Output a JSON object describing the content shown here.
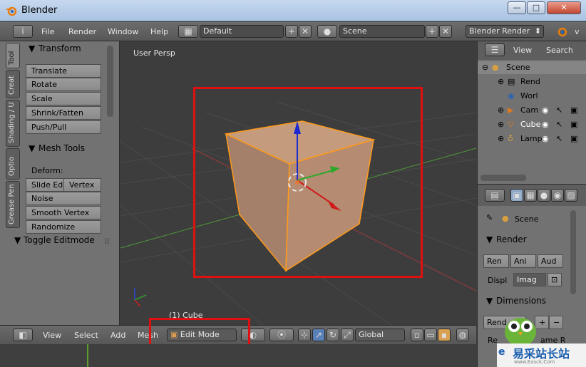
{
  "window": {
    "title": "Blender",
    "min_label": "—",
    "max_label": "□",
    "close_label": "✕"
  },
  "header": {
    "menus": [
      "File",
      "Render",
      "Window",
      "Help"
    ],
    "layout_value": "Default",
    "scene_value": "Scene",
    "engine_value": "Blender Render",
    "engine_cut": "v"
  },
  "tool_tabs": [
    "Tool",
    "Creat",
    "Shading / U",
    "Optio",
    "Grease Pen"
  ],
  "tool_panel": {
    "transform_header": "Transform",
    "transform_buttons": [
      "Translate",
      "Rotate",
      "Scale",
      "Shrink/Fatten",
      "Push/Pull"
    ],
    "mesh_tools_header": "Mesh Tools",
    "deform_label": "Deform:",
    "slide_edge": "Slide Ed",
    "vertex": "Vertex",
    "mesh_buttons": [
      "Noise",
      "Smooth Vertex",
      "Randomize"
    ],
    "toggle_editmode": "Toggle Editmode"
  },
  "viewport": {
    "view_label": "User Persp",
    "object_label": "(1) Cube"
  },
  "bottom_bar": {
    "menus": [
      "View",
      "Select",
      "Add",
      "Mesh"
    ],
    "mode_value": "Edit Mode",
    "orientation_value": "Global"
  },
  "outliner": {
    "view_menu": "View",
    "search_menu": "Search",
    "items": [
      "Scene",
      "Rend",
      "Worl",
      "Cam",
      "Cube",
      "Lamp"
    ]
  },
  "properties": {
    "context": "Scene",
    "render_header": "Render",
    "render_buttons": [
      "Ren",
      "Ani",
      "Aud"
    ],
    "display_label": "Displ",
    "display_value": "Imag",
    "dimensions_header": "Dimensions",
    "render_preset": "Rend",
    "resolution_label": "Re",
    "frame_label": "ame R"
  },
  "watermark": {
    "text": "易采站长站",
    "subtext": "www.Easck.Com"
  },
  "colors": {
    "highlight_box": "#e01010",
    "cube_face": "#b08a6e",
    "cube_edge": "#ff9a1a"
  }
}
